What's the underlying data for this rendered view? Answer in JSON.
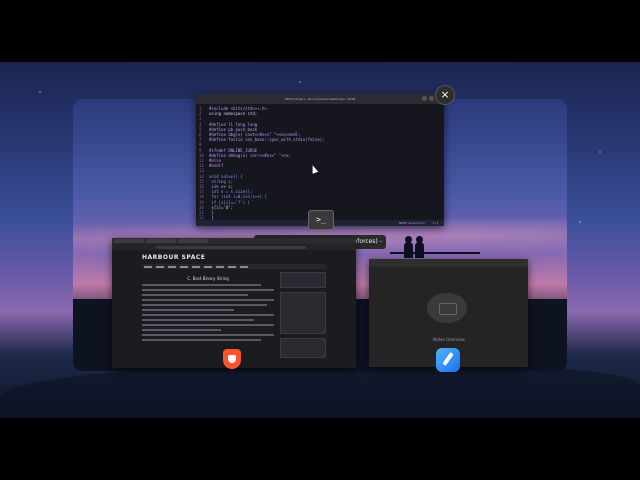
{
  "overview": {
    "nvim_window_title": "1837Ccf.cpp (~/Documents/codeforces) - NVIM",
    "hover_tooltip": "1837Ccf.cpp (~/Documents/codeforces) - NVIM",
    "close_label": "×",
    "terminal_icon_label": ">_"
  },
  "nvim": {
    "status_mode": "NVIM Insertion",
    "status_pos": "1:1",
    "lines": [
      "#include <bits/stdc++.h>",
      "using namespace std;",
      "",
      "#define ll long long",
      "#define pb push_back",
      "#define dbg(x) cout<<#x<<\" \"<<x<<endl;",
      "#define fastio ios_base::sync_with_stdio(false);",
      "",
      "#ifndef ONLINE_JUDGE",
      "#define debug(x) cerr<<#x<<\" \"<<x;",
      "#else",
      "#endif",
      "",
      "void solve() {",
      "  string s;",
      "  cin >> s;",
      "  int n = s.size();",
      "  for (int i=0;i<n;i++) {",
      "    if (s[i]=='?') {",
      "      s[i]='0';",
      "    }",
      "  }",
      "",
      "  for (int i=1;i<n;i++) {",
      "    if (s[i]=='?') {",
      "      s[i]=s[i-1];",
      "    }",
      "  }",
      "}"
    ]
  },
  "browser": {
    "site_logo": "HARBOUR SPACE",
    "problem_title": "C. Best Binary String"
  },
  "notes": {
    "caption": "Notes Overview"
  }
}
